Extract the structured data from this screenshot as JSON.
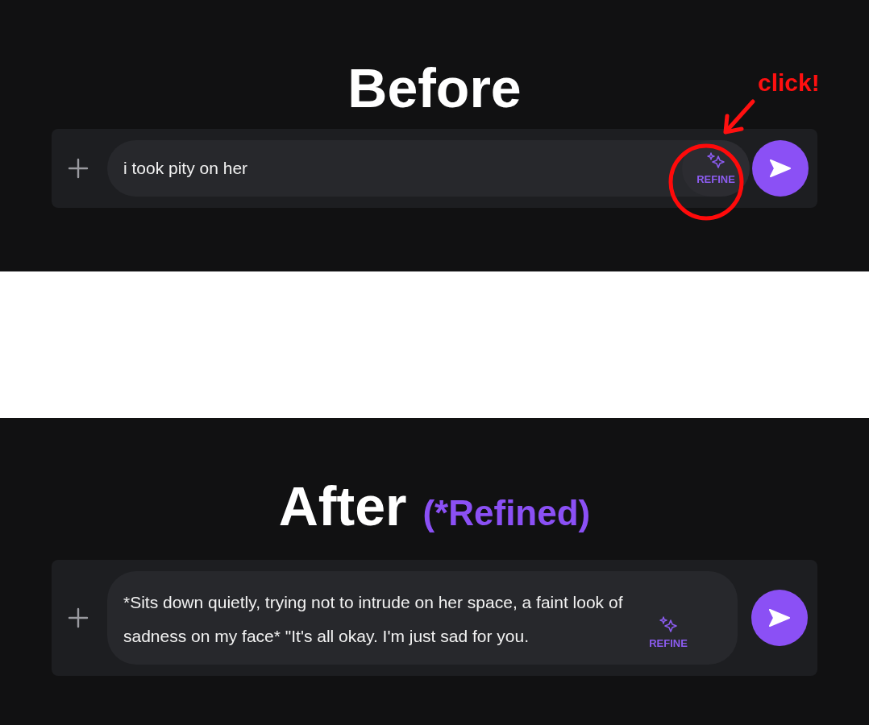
{
  "panels": [
    {
      "heading": "Before",
      "composer": {
        "text": "i took pity on her",
        "refine_label": "REFINE"
      },
      "annotation": {
        "label": "click!"
      }
    },
    {
      "heading": "After",
      "tag": "(*Refined)",
      "composer": {
        "text": "*Sits down quietly, trying not to intrude on her space, a faint look of sadness on my face* \"It's all okay. I'm just sad for you.",
        "refine_label": "REFINE"
      }
    }
  ]
}
